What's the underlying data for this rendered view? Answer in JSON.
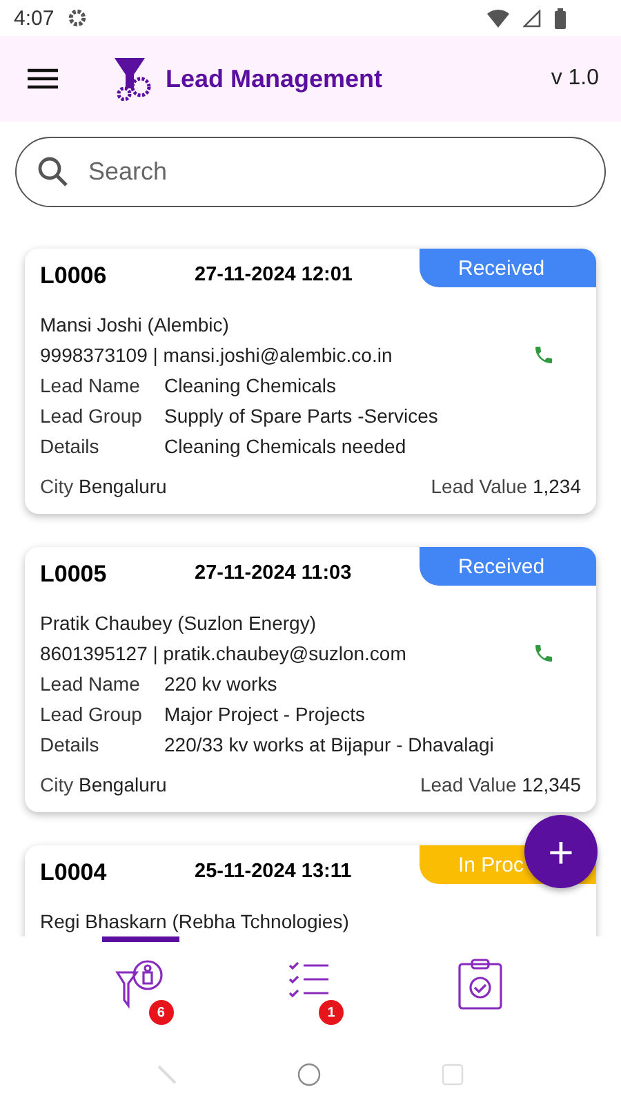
{
  "status_bar": {
    "time": "4:07"
  },
  "header": {
    "title": "Lead Management",
    "version": "v 1.0"
  },
  "search": {
    "placeholder": "Search"
  },
  "leads": [
    {
      "id": "L0006",
      "datetime": "27-11-2024 12:01",
      "status": "Received",
      "color": "#4285f4",
      "contact": "Mansi Joshi (Alembic)",
      "phone": "9998373109",
      "separator": "|",
      "email": "mansi.joshi@alembic.co.in",
      "fields": [
        {
          "label": "Lead Name",
          "value": "Cleaning Chemicals"
        },
        {
          "label": "Lead Group",
          "value": "Supply of Spare Parts -Services"
        },
        {
          "label": "Details",
          "value": "Cleaning Chemicals needed"
        }
      ],
      "city_label": "City",
      "city": "Bengaluru",
      "value_label": "Lead Value",
      "value": "1,234"
    },
    {
      "id": "L0005",
      "datetime": "27-11-2024 11:03",
      "status": "Received",
      "color": "#4285f4",
      "contact": "Pratik Chaubey  (Suzlon Energy)",
      "phone": "8601395127",
      "separator": "|",
      "email": "pratik.chaubey@suzlon.com",
      "fields": [
        {
          "label": "Lead Name",
          "value": "220 kv works"
        },
        {
          "label": "Lead Group",
          "value": "Major Project - Projects"
        },
        {
          "label": "Details",
          "value": "220/33 kv works at Bijapur - Dhavalagi"
        }
      ],
      "city_label": "City",
      "city": "Bengaluru",
      "value_label": "Lead Value",
      "value": "12,345"
    },
    {
      "id": "L0004",
      "datetime": "25-11-2024 13:11",
      "status": "In Proc",
      "color": "#fbbc04",
      "contact": "Regi Bhaskarn (Rebha Tchnologies)"
    }
  ],
  "fab": {
    "label": "+"
  },
  "nav": [
    {
      "kind": "leads",
      "selected": true,
      "badge": "6"
    },
    {
      "kind": "tasks",
      "selected": false,
      "badge": "1"
    },
    {
      "kind": "report",
      "selected": false
    }
  ]
}
